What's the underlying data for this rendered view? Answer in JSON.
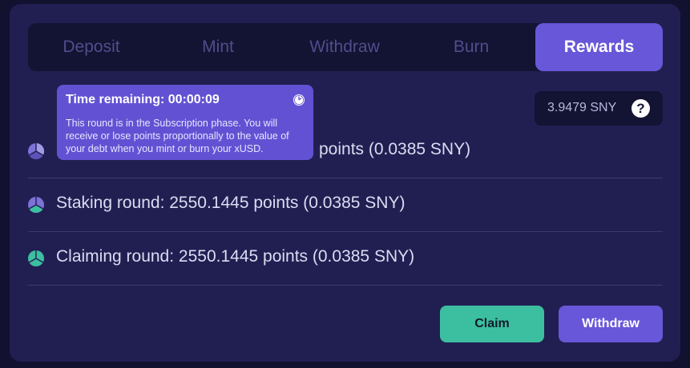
{
  "tabs": [
    {
      "label": "Deposit",
      "active": false
    },
    {
      "label": "Mint",
      "active": false
    },
    {
      "label": "Withdraw",
      "active": false
    },
    {
      "label": "Burn",
      "active": false
    },
    {
      "label": "Rewards",
      "active": true
    }
  ],
  "balance": {
    "value": "3.9479 SNY",
    "help_icon": "?"
  },
  "tooltip": {
    "title": "Time remaining: 00:00:09",
    "icon": "clock-icon",
    "body": "This round is in the Subscription phase. You will receive or lose points proportionally to the value of your debt when you mint or burn your xUSD."
  },
  "rounds": [
    {
      "visible_text": "points (0.0385 SNY)",
      "icon": "round-pie-icon"
    },
    {
      "text": "Staking round: 2550.1445 points (0.0385 SNY)",
      "icon": "round-pie-icon"
    },
    {
      "text": "Claiming round: 2550.1445 points (0.0385 SNY)",
      "icon": "round-pie-icon"
    }
  ],
  "actions": {
    "claim": "Claim",
    "withdraw": "Withdraw"
  },
  "colors": {
    "accent": "#6857d8",
    "green": "#3cbfa0",
    "panel": "#211f52"
  }
}
